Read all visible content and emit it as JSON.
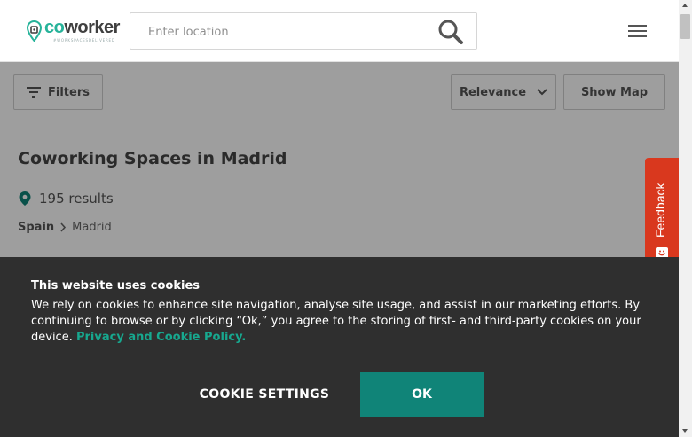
{
  "header": {
    "logo": {
      "co": "co",
      "worker": "worker",
      "tagline": "#WORKSPACESDELIVERED"
    },
    "search": {
      "placeholder": "Enter location"
    }
  },
  "toolbar": {
    "filters_label": "Filters",
    "sort_label": "Relevance",
    "map_label": "Show Map"
  },
  "main": {
    "title": "Coworking Spaces in Madrid",
    "results": "195 results",
    "breadcrumb": [
      "Spain",
      "Madrid"
    ]
  },
  "feedback": {
    "label": "Feedback"
  },
  "cookie_banner": {
    "title": "This website uses cookies",
    "body": "We rely on cookies to enhance site navigation, analyse site usage, and assist in our marketing efforts. By continuing to browse or by clicking “Ok,” you agree to the storing of first- and third-party cookies on your device. ",
    "link": "Privacy and Cookie Policy.",
    "settings_label": "COOKIE SETTINGS",
    "ok_label": "OK"
  },
  "colors": {
    "brand_green": "#27b39a",
    "ok_button": "#108478",
    "feedback_red": "#d9381e",
    "banner_bg": "#2f2f2f"
  },
  "icons": [
    "logo-pin-icon",
    "search-icon",
    "hamburger-menu-icon",
    "filter-icon",
    "chevron-down-icon",
    "location-pin-icon",
    "chevron-right-icon",
    "feedback-icon"
  ]
}
